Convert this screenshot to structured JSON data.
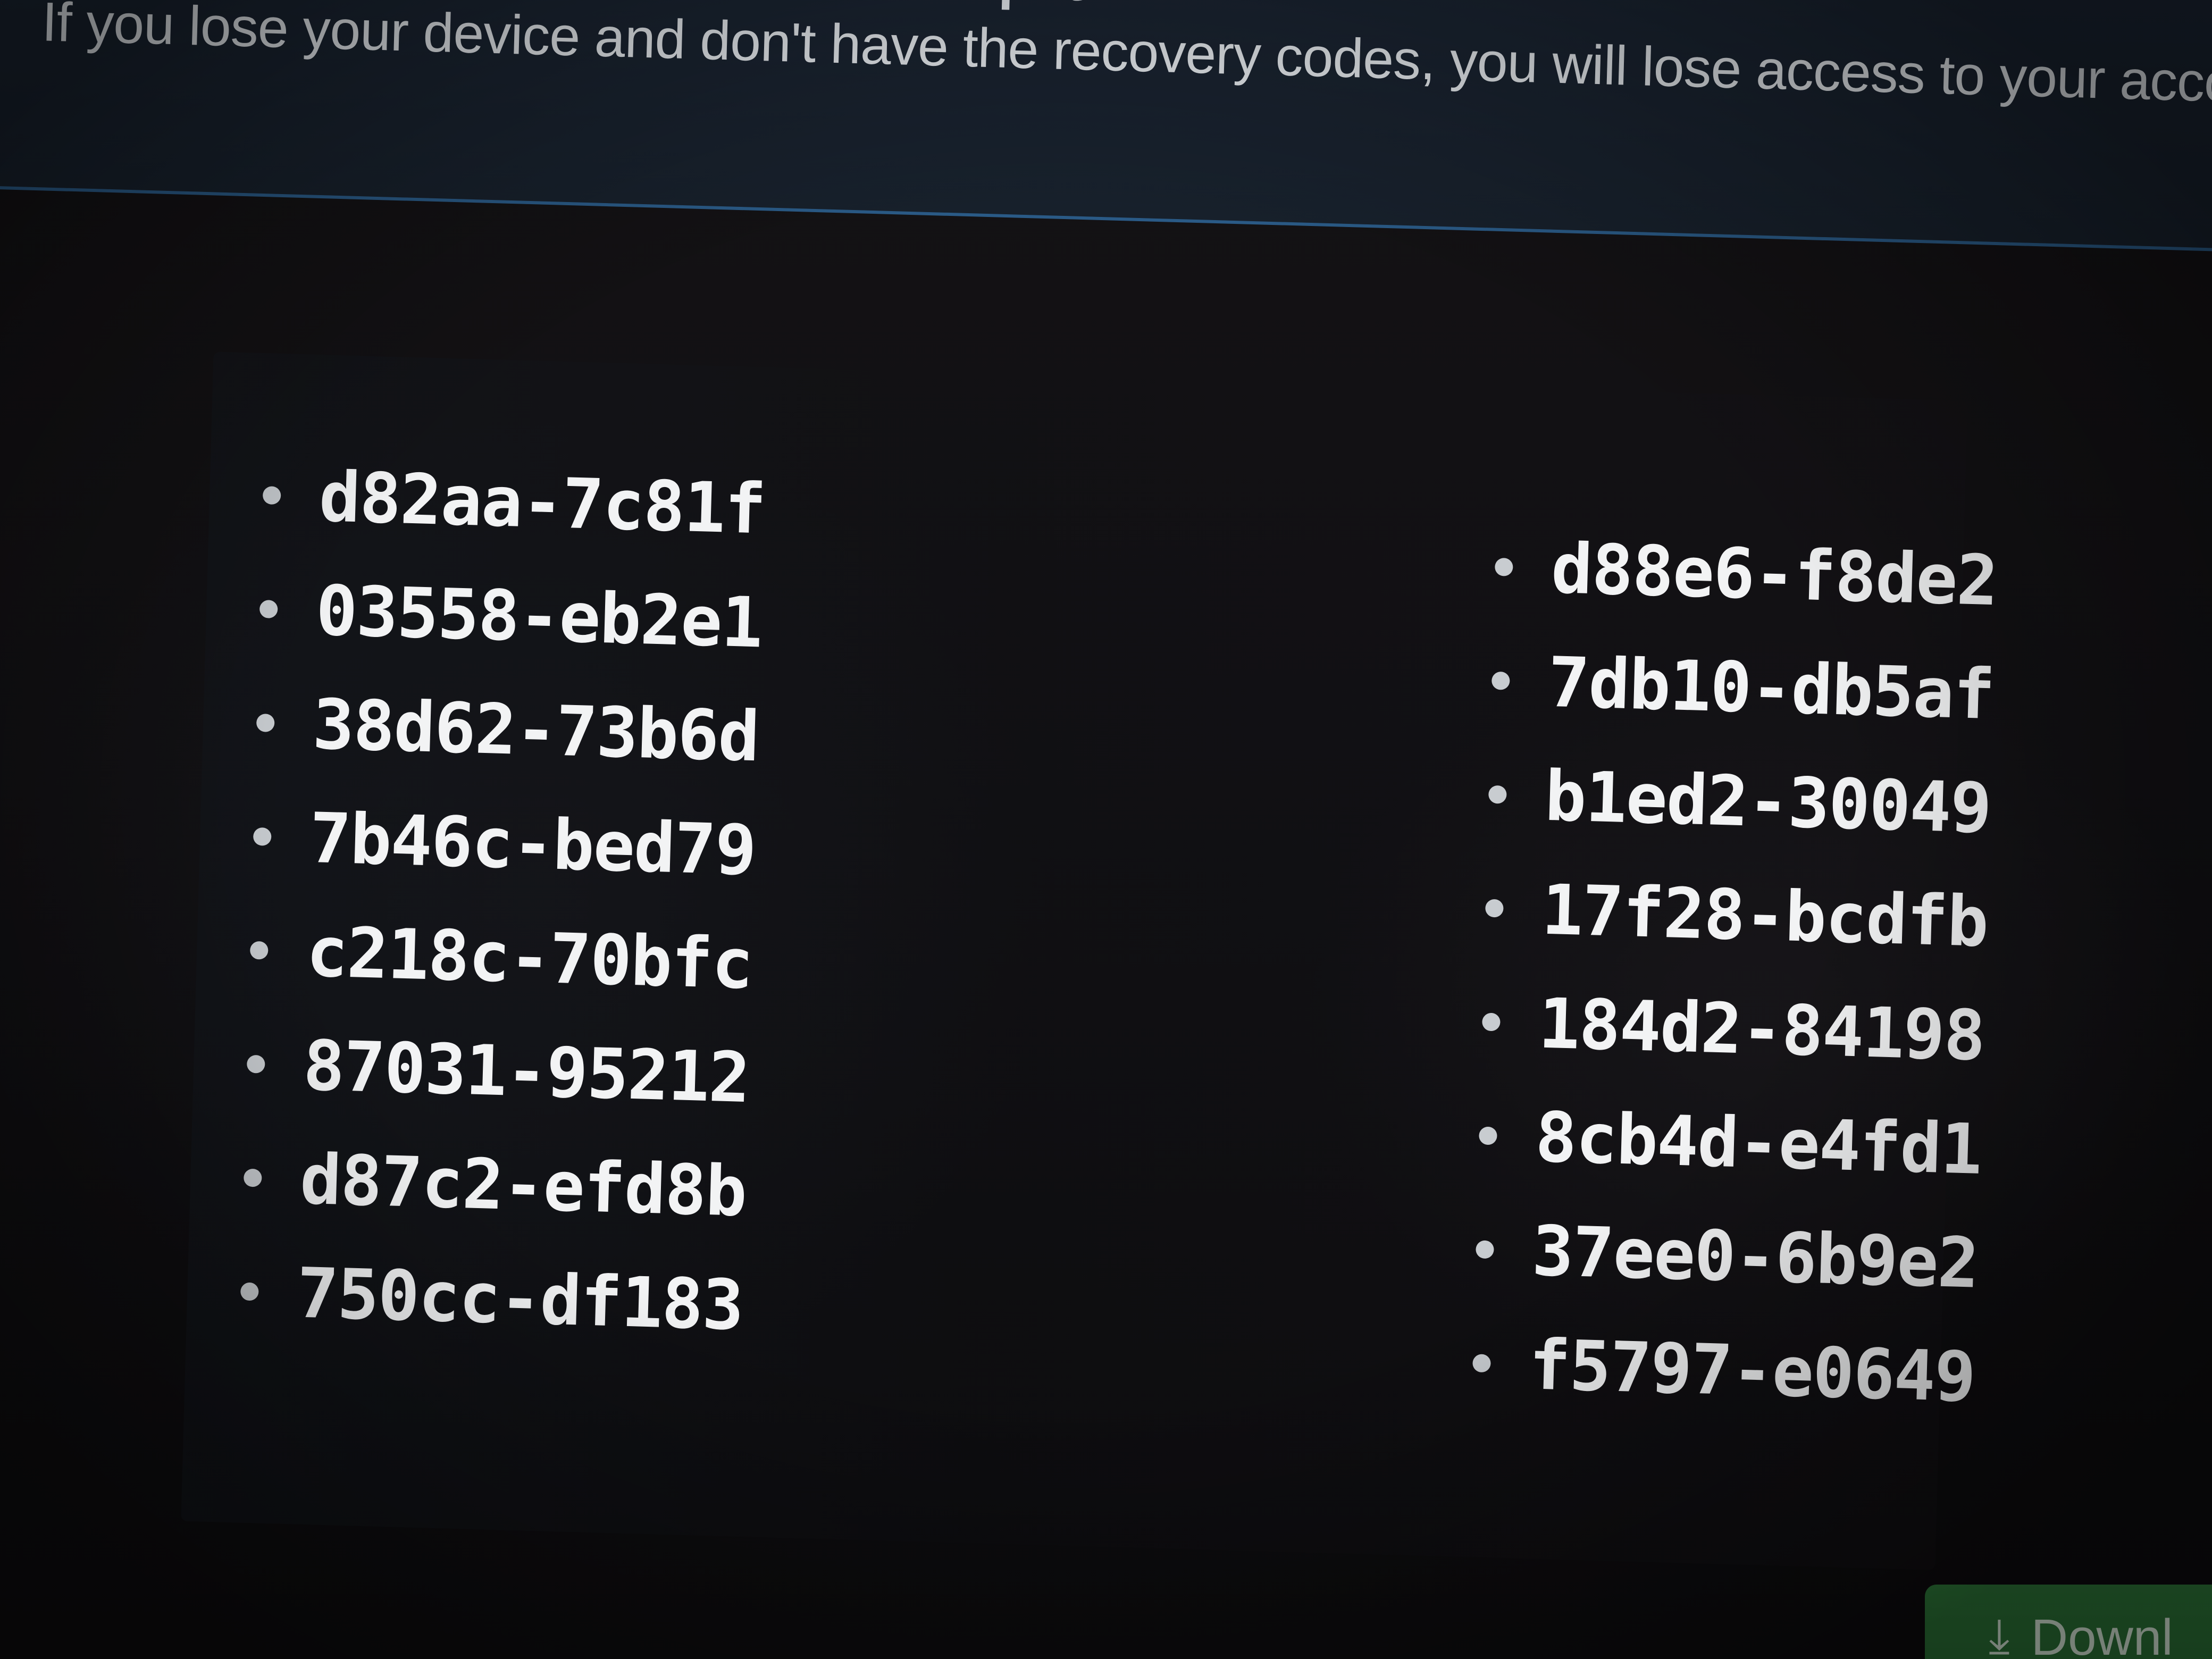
{
  "flash": {
    "title": "Keep your recovery codes in a safe spot",
    "body": "If you lose your device and don't have the recovery codes, you will lose access to your acco"
  },
  "recovery_codes": {
    "left": [
      "d82aa-7c81f",
      "03558-eb2e1",
      "38d62-73b6d",
      "7b46c-bed79",
      "c218c-70bfc",
      "87031-95212",
      "d87c2-efd8b",
      "750cc-df183"
    ],
    "right": [
      "d88e6-f8de2",
      "7db10-db5af",
      "b1ed2-30049",
      "17f28-bcdfb",
      "184d2-84198",
      "8cb4d-e4fd1",
      "37ee0-6b9e2",
      "f5797-e0649"
    ]
  },
  "actions": {
    "download_label": "Downl",
    "download_icon": "download-icon"
  },
  "colors": {
    "flash_background": "#1b2533",
    "flash_border": "#2a5a86",
    "panel_background": "#111013",
    "download_button": "#2f7a3a"
  }
}
